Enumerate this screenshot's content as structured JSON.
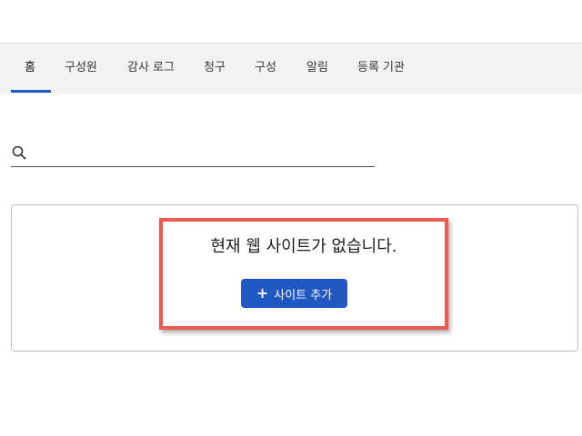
{
  "tabs": [
    {
      "label": "홈",
      "active": true
    },
    {
      "label": "구성원",
      "active": false
    },
    {
      "label": "감사 로그",
      "active": false
    },
    {
      "label": "청구",
      "active": false
    },
    {
      "label": "구성",
      "active": false
    },
    {
      "label": "알림",
      "active": false
    },
    {
      "label": "등록 기관",
      "active": false
    }
  ],
  "search": {
    "icon": "search-icon",
    "placeholder": "",
    "value": ""
  },
  "empty_state": {
    "message": "현재 웹 사이트가 없습니다.",
    "add_button_icon": "plus-icon",
    "add_button_label": "사이트 추가"
  },
  "colors": {
    "accent": "#1f57c3",
    "highlight_border": "#ec5b52",
    "tab_bar_bg": "#f2f2f2"
  }
}
